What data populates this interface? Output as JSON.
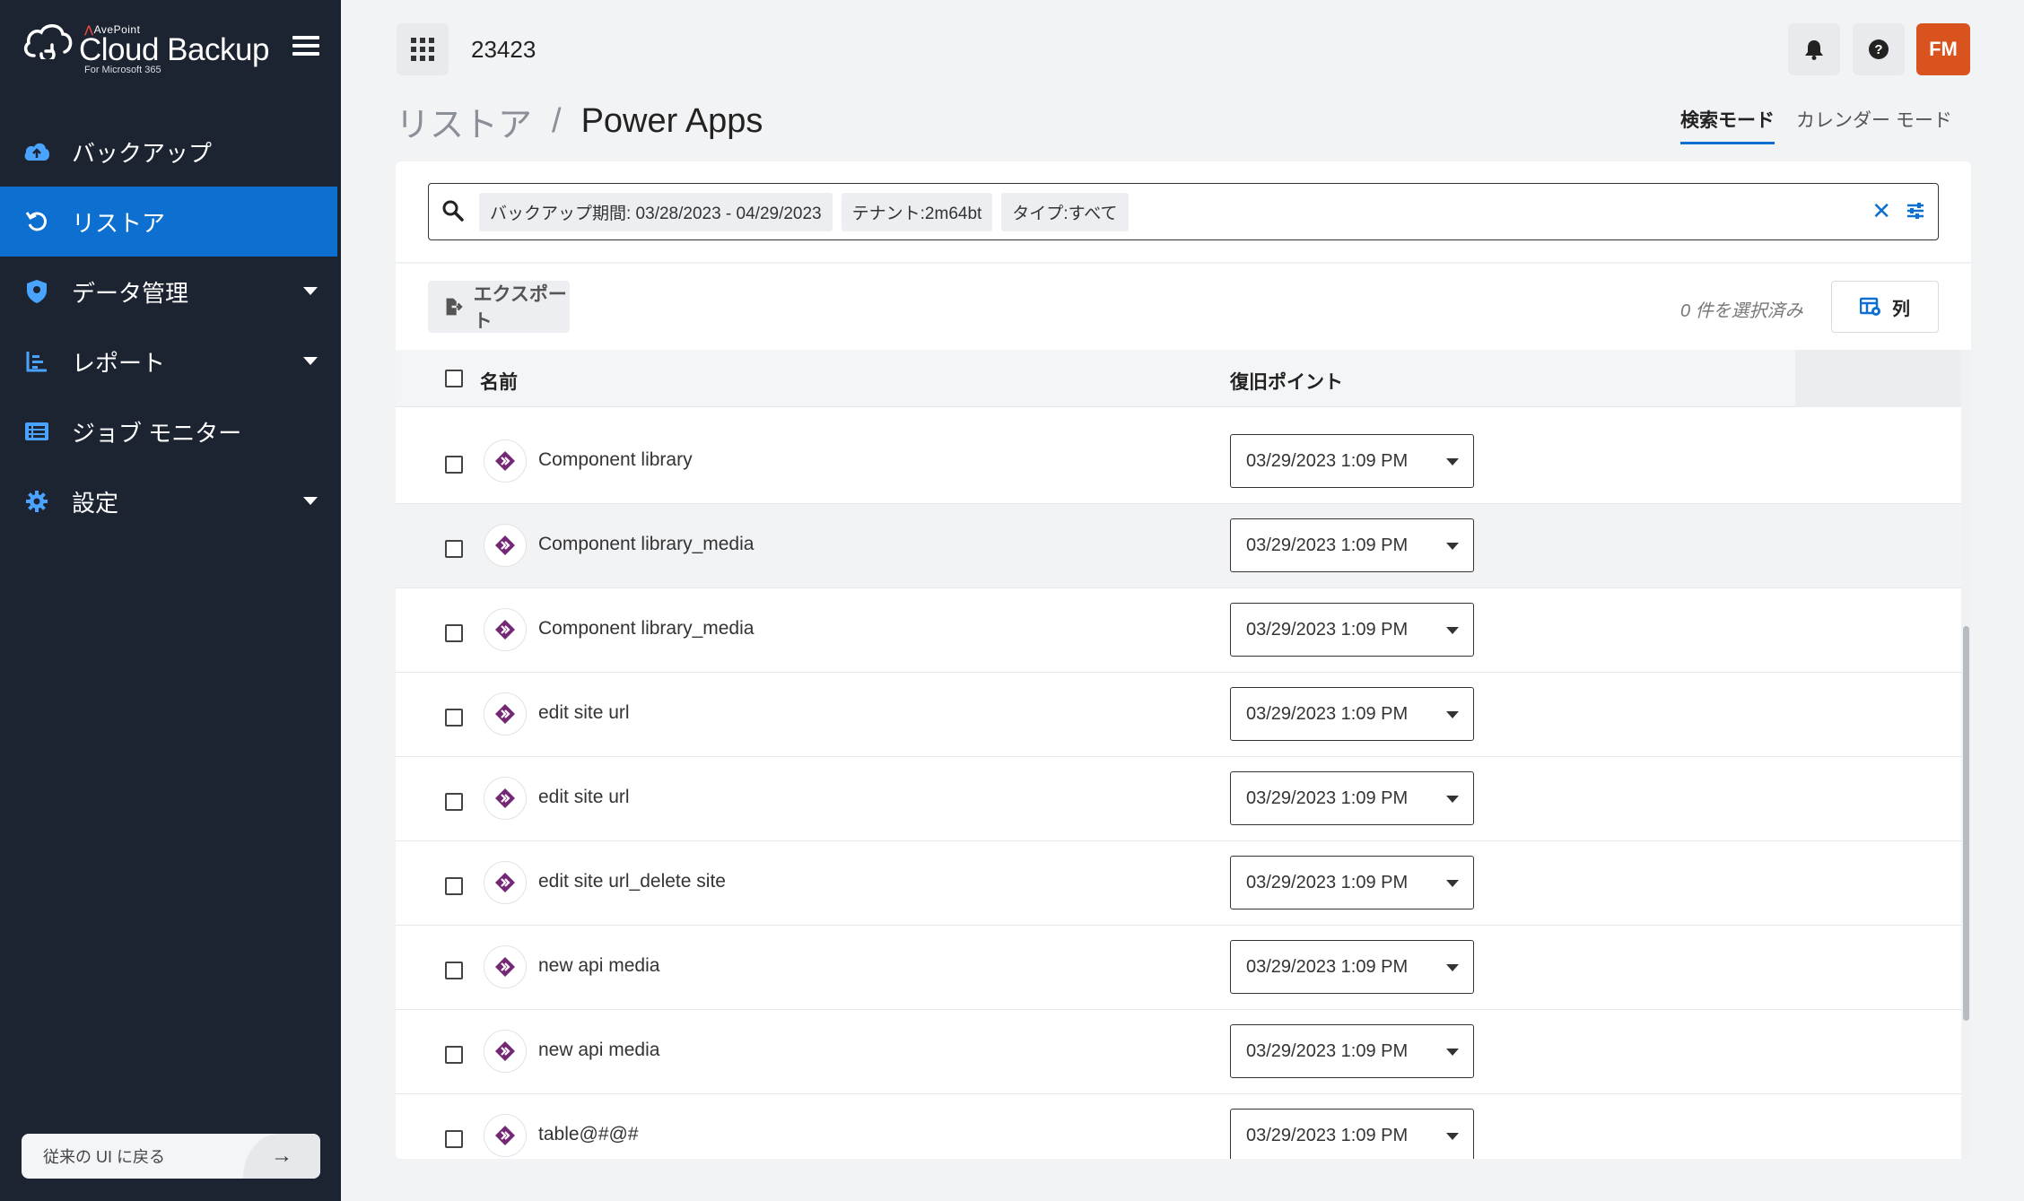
{
  "brand": {
    "company": "AvePoint",
    "product": "Cloud Backup",
    "subtitle": "For Microsoft 365"
  },
  "sidebar": {
    "items": [
      {
        "label": "バックアップ",
        "icon": "cloud-upload-icon",
        "active": false,
        "expandable": false
      },
      {
        "label": "リストア",
        "icon": "restore-icon",
        "active": true,
        "expandable": false
      },
      {
        "label": "データ管理",
        "icon": "shield-icon",
        "active": false,
        "expandable": true
      },
      {
        "label": "レポート",
        "icon": "report-icon",
        "active": false,
        "expandable": true
      },
      {
        "label": "ジョブ モニター",
        "icon": "job-monitor-icon",
        "active": false,
        "expandable": false
      },
      {
        "label": "設定",
        "icon": "gear-icon",
        "active": false,
        "expandable": true
      }
    ],
    "legacy_label": "従来の UI に戻る",
    "legacy_arrow": "→"
  },
  "header": {
    "tenant_id": "23423",
    "avatar_initials": "FM"
  },
  "breadcrumb": {
    "root": "リストア",
    "separator": "/",
    "current": "Power Apps"
  },
  "modes": {
    "search": "検索モード",
    "calendar": "カレンダー モード"
  },
  "search": {
    "chips": [
      "バックアップ期間: 03/28/2023 - 04/29/2023",
      "テナント:2m64bt",
      "タイプ:すべて"
    ],
    "value": "",
    "clear_glyph": "✕"
  },
  "toolbar": {
    "export_label": "エクスポート",
    "selection_text": "0 件を選択済み",
    "columns_label": "列"
  },
  "table": {
    "columns": [
      "名前",
      "復旧ポイント"
    ],
    "rows": [
      {
        "name": "Component library",
        "restore_point": "03/29/2023 1:09 PM"
      },
      {
        "name": "Component library_media",
        "restore_point": "03/29/2023 1:09 PM"
      },
      {
        "name": "Component library_media",
        "restore_point": "03/29/2023 1:09 PM"
      },
      {
        "name": "edit site url",
        "restore_point": "03/29/2023 1:09 PM"
      },
      {
        "name": "edit site url",
        "restore_point": "03/29/2023 1:09 PM"
      },
      {
        "name": "edit site url_delete site",
        "restore_point": "03/29/2023 1:09 PM"
      },
      {
        "name": "new api media",
        "restore_point": "03/29/2023 1:09 PM"
      },
      {
        "name": "new api media",
        "restore_point": "03/29/2023 1:09 PM"
      },
      {
        "name": "table@#@#",
        "restore_point": "03/29/2023 1:09 PM"
      }
    ],
    "hovered_row": 1
  },
  "colors": {
    "sidebar_bg": "#1c2331",
    "accent": "#0d6fd0",
    "avatar": "#d9531e",
    "power_apps": "#742774"
  }
}
